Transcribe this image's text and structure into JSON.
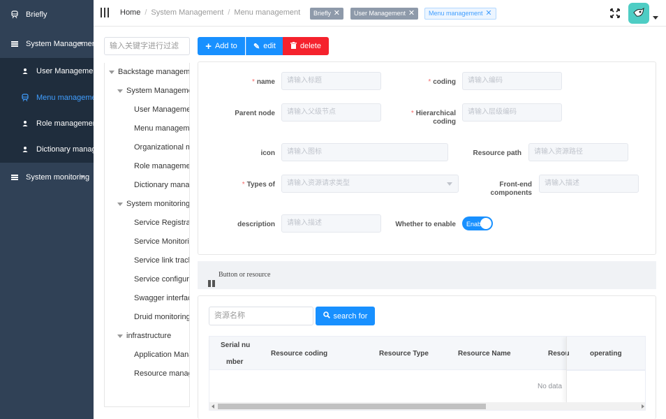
{
  "sidebar": {
    "brand": "Briefly",
    "groups": [
      {
        "label": "System Management"
      },
      {
        "label": "System monitoring"
      }
    ],
    "items": [
      {
        "label": "User Management"
      },
      {
        "label": "Menu management"
      },
      {
        "label": "Role management"
      },
      {
        "label": "Dictionary management"
      }
    ],
    "bg_color": "#304156",
    "active_color": "#409eff"
  },
  "topbar": {
    "breadcrumb": [
      "Home",
      "System Management",
      "Menu management"
    ],
    "tags": [
      {
        "label": "Briefly"
      },
      {
        "label": "User Management"
      },
      {
        "label": "Menu management"
      }
    ]
  },
  "tree": {
    "filter_placeholder": "输入关键字进行过滤",
    "root": "Backstage management",
    "nodes": [
      {
        "label": "System Management"
      },
      {
        "label": "User Management"
      },
      {
        "label": "Menu management"
      },
      {
        "label": "Organizational management"
      },
      {
        "label": "Role management"
      },
      {
        "label": "Dictionary management"
      },
      {
        "label": "System monitoring"
      },
      {
        "label": "Service Registration"
      },
      {
        "label": "Service Monitoring"
      },
      {
        "label": "Service link tracking"
      },
      {
        "label": "Service configuration"
      },
      {
        "label": "Swagger interface"
      },
      {
        "label": "Druid monitoring"
      },
      {
        "label": "infrastructure"
      },
      {
        "label": "Application Management"
      },
      {
        "label": "Resource management"
      }
    ]
  },
  "toolbar": {
    "add_label": "Add to",
    "edit_label": "edit",
    "delete_label": "delete"
  },
  "form": {
    "name_label": "name",
    "name_placeholder": "请输入标题",
    "coding_label": "coding",
    "coding_placeholder": "请输入编码",
    "parent_label": "Parent node",
    "parent_placeholder": "请输入父级节点",
    "hier_label_1": "Hierarchical",
    "hier_label_2": "coding",
    "hier_placeholder": "请输入层级编码",
    "icon_label": "icon",
    "icon_placeholder": "请输入图标",
    "respath_label": "Resource path",
    "respath_placeholder": "请输入资源路径",
    "types_label": "Types of",
    "types_placeholder": "请输入资源请求类型",
    "front_label_1": "Front-end",
    "front_label_2": "components",
    "front_placeholder": "请输入描述",
    "desc_label": "description",
    "desc_placeholder": "请输入描述",
    "enable_label": "Whether to enable",
    "enable_state": "Enable"
  },
  "resources": {
    "section_title": "Button or resource",
    "search_placeholder": "资源名称",
    "search_button": "search for",
    "columns": [
      "Serial nu",
      "mber",
      "Resource coding",
      "Resource Type",
      "Resource Name",
      "Resou",
      "operating"
    ],
    "empty_text": "No data"
  }
}
